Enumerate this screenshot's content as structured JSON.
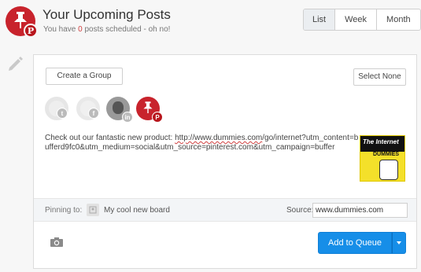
{
  "header": {
    "title": "Your Upcoming Posts",
    "subtitle_pre": "You have ",
    "subtitle_count": "0",
    "subtitle_post": " posts scheduled - oh no!",
    "avatar_badge": "P"
  },
  "view_tabs": [
    "List",
    "Week",
    "Month"
  ],
  "composer": {
    "create_group_label": "Create a Group",
    "select_none_label": "Select None",
    "profiles": [
      {
        "network": "twitter",
        "badge": "t"
      },
      {
        "network": "facebook",
        "badge": "f"
      },
      {
        "network": "linkedin",
        "badge": "in"
      },
      {
        "network": "pinterest",
        "badge": "P",
        "selected": true
      }
    ],
    "post_text_prefix": "Check out our fantastic new product: ",
    "post_url": "http://www.dummies.com",
    "post_text_rest": "/go/internet?utm_content=bufferd9fc0&utm_medium=social&utm_source=pinterest.com&utm_campaign=buffer",
    "thumbnail": {
      "title": "The Internet",
      "subtitle": "DUMMIES"
    },
    "pinning_label": "Pinning to:",
    "board_name": "My cool new board",
    "source_label": "Source:",
    "source_value": "www.dummies.com",
    "add_to_queue_label": "Add to Queue"
  },
  "colors": {
    "brand_red": "#c8232c",
    "accent_blue": "#168ee8",
    "alert_red": "#d04040"
  }
}
